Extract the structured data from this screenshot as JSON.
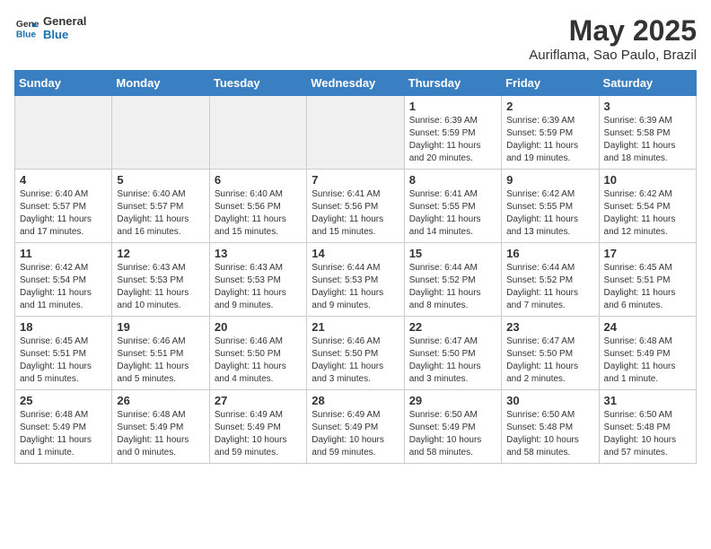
{
  "header": {
    "logo_line1": "General",
    "logo_line2": "Blue",
    "title": "May 2025",
    "subtitle": "Auriflama, Sao Paulo, Brazil"
  },
  "days_of_week": [
    "Sunday",
    "Monday",
    "Tuesday",
    "Wednesday",
    "Thursday",
    "Friday",
    "Saturday"
  ],
  "weeks": [
    [
      {
        "day": "",
        "empty": true
      },
      {
        "day": "",
        "empty": true
      },
      {
        "day": "",
        "empty": true
      },
      {
        "day": "",
        "empty": true
      },
      {
        "day": "1",
        "sunrise": "6:39 AM",
        "sunset": "5:59 PM",
        "daylight": "11 hours and 20 minutes."
      },
      {
        "day": "2",
        "sunrise": "6:39 AM",
        "sunset": "5:59 PM",
        "daylight": "11 hours and 19 minutes."
      },
      {
        "day": "3",
        "sunrise": "6:39 AM",
        "sunset": "5:58 PM",
        "daylight": "11 hours and 18 minutes."
      }
    ],
    [
      {
        "day": "4",
        "sunrise": "6:40 AM",
        "sunset": "5:57 PM",
        "daylight": "11 hours and 17 minutes."
      },
      {
        "day": "5",
        "sunrise": "6:40 AM",
        "sunset": "5:57 PM",
        "daylight": "11 hours and 16 minutes."
      },
      {
        "day": "6",
        "sunrise": "6:40 AM",
        "sunset": "5:56 PM",
        "daylight": "11 hours and 15 minutes."
      },
      {
        "day": "7",
        "sunrise": "6:41 AM",
        "sunset": "5:56 PM",
        "daylight": "11 hours and 15 minutes."
      },
      {
        "day": "8",
        "sunrise": "6:41 AM",
        "sunset": "5:55 PM",
        "daylight": "11 hours and 14 minutes."
      },
      {
        "day": "9",
        "sunrise": "6:42 AM",
        "sunset": "5:55 PM",
        "daylight": "11 hours and 13 minutes."
      },
      {
        "day": "10",
        "sunrise": "6:42 AM",
        "sunset": "5:54 PM",
        "daylight": "11 hours and 12 minutes."
      }
    ],
    [
      {
        "day": "11",
        "sunrise": "6:42 AM",
        "sunset": "5:54 PM",
        "daylight": "11 hours and 11 minutes."
      },
      {
        "day": "12",
        "sunrise": "6:43 AM",
        "sunset": "5:53 PM",
        "daylight": "11 hours and 10 minutes."
      },
      {
        "day": "13",
        "sunrise": "6:43 AM",
        "sunset": "5:53 PM",
        "daylight": "11 hours and 9 minutes."
      },
      {
        "day": "14",
        "sunrise": "6:44 AM",
        "sunset": "5:53 PM",
        "daylight": "11 hours and 9 minutes."
      },
      {
        "day": "15",
        "sunrise": "6:44 AM",
        "sunset": "5:52 PM",
        "daylight": "11 hours and 8 minutes."
      },
      {
        "day": "16",
        "sunrise": "6:44 AM",
        "sunset": "5:52 PM",
        "daylight": "11 hours and 7 minutes."
      },
      {
        "day": "17",
        "sunrise": "6:45 AM",
        "sunset": "5:51 PM",
        "daylight": "11 hours and 6 minutes."
      }
    ],
    [
      {
        "day": "18",
        "sunrise": "6:45 AM",
        "sunset": "5:51 PM",
        "daylight": "11 hours and 5 minutes."
      },
      {
        "day": "19",
        "sunrise": "6:46 AM",
        "sunset": "5:51 PM",
        "daylight": "11 hours and 5 minutes."
      },
      {
        "day": "20",
        "sunrise": "6:46 AM",
        "sunset": "5:50 PM",
        "daylight": "11 hours and 4 minutes."
      },
      {
        "day": "21",
        "sunrise": "6:46 AM",
        "sunset": "5:50 PM",
        "daylight": "11 hours and 3 minutes."
      },
      {
        "day": "22",
        "sunrise": "6:47 AM",
        "sunset": "5:50 PM",
        "daylight": "11 hours and 3 minutes."
      },
      {
        "day": "23",
        "sunrise": "6:47 AM",
        "sunset": "5:50 PM",
        "daylight": "11 hours and 2 minutes."
      },
      {
        "day": "24",
        "sunrise": "6:48 AM",
        "sunset": "5:49 PM",
        "daylight": "11 hours and 1 minute."
      }
    ],
    [
      {
        "day": "25",
        "sunrise": "6:48 AM",
        "sunset": "5:49 PM",
        "daylight": "11 hours and 1 minute."
      },
      {
        "day": "26",
        "sunrise": "6:48 AM",
        "sunset": "5:49 PM",
        "daylight": "11 hours and 0 minutes."
      },
      {
        "day": "27",
        "sunrise": "6:49 AM",
        "sunset": "5:49 PM",
        "daylight": "10 hours and 59 minutes."
      },
      {
        "day": "28",
        "sunrise": "6:49 AM",
        "sunset": "5:49 PM",
        "daylight": "10 hours and 59 minutes."
      },
      {
        "day": "29",
        "sunrise": "6:50 AM",
        "sunset": "5:49 PM",
        "daylight": "10 hours and 58 minutes."
      },
      {
        "day": "30",
        "sunrise": "6:50 AM",
        "sunset": "5:48 PM",
        "daylight": "10 hours and 58 minutes."
      },
      {
        "day": "31",
        "sunrise": "6:50 AM",
        "sunset": "5:48 PM",
        "daylight": "10 hours and 57 minutes."
      }
    ]
  ]
}
